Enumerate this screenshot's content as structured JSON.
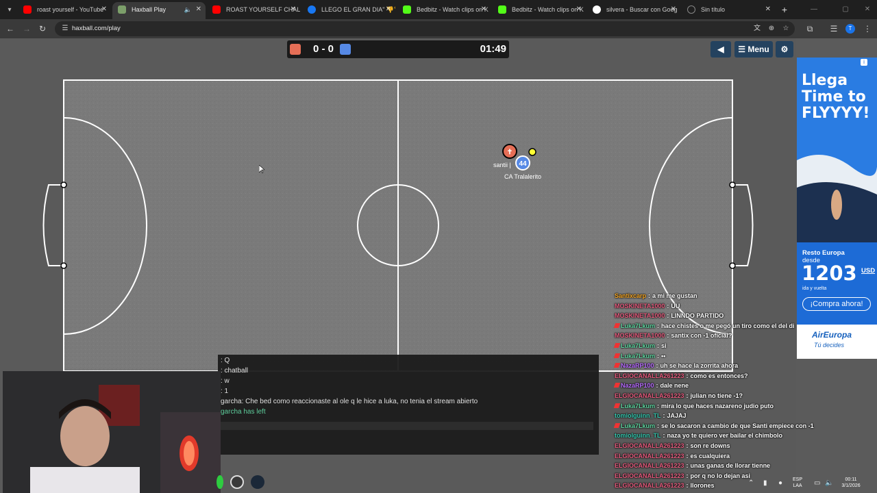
{
  "tabs": [
    {
      "title": "roast yourself - YouTube",
      "fav_color": "#ff0000"
    },
    {
      "title": "Haxball Play",
      "fav_color": "#7c9f6a"
    },
    {
      "title": "ROAST YOURSELF CHALL",
      "fav_color": "#ff0000"
    },
    {
      "title": "LLEGO EL GRAN DIA\" 👎🏆",
      "fav_color": "#1877f2"
    },
    {
      "title": "Bedbitz - Watch clips on K",
      "fav_color": "#53fc18"
    },
    {
      "title": "Bedbitz - Watch clips on K",
      "fav_color": "#53fc18"
    },
    {
      "title": "silvera - Buscar con Goog",
      "fav_color": "#ffffff"
    },
    {
      "title": "Sin título",
      "fav_color": "#1f1f1f"
    }
  ],
  "toolbar": {
    "url": "haxball.com/play"
  },
  "scoreboard": {
    "red_score": "0",
    "separator": "-",
    "blue_score": "0",
    "timer": "01:49",
    "red_color": "#e56e56",
    "blue_color": "#5689e5"
  },
  "game_menu": {
    "menu_label": "Menu"
  },
  "players": {
    "red_name": "santii |",
    "red_number": "✝",
    "blue_name": "CA Tralalerito",
    "blue_number": "44"
  },
  "chat": {
    "lines": [
      ": Q",
      ": chatball",
      ": w",
      ": 1",
      "garcha: Che bed como reaccionaste al ole q le hice a luka, no tenia el stream abierto"
    ],
    "system_line": "garcha has left"
  },
  "stream_chat": [
    {
      "user": "Santixcarp",
      "color": "#f5a623",
      "badge": false,
      "msg": "a mi me gustan"
    },
    {
      "user": "MOSKINETA1000",
      "color": "#e55b7d",
      "badge": false,
      "msg": "UU"
    },
    {
      "user": "MOSKINETA1000",
      "color": "#e55b7d",
      "badge": false,
      "msg": "LINNDO PARTIDO"
    },
    {
      "user": "Luka7Lkum",
      "color": "#5fd4a0",
      "badge": true,
      "msg": "hace chistes o me pegó un tiro como el del di"
    },
    {
      "user": "MOSKINETA1000",
      "color": "#e55b7d",
      "badge": false,
      "msg": "santix con -1 oficial?"
    },
    {
      "user": "Luka7Lkum",
      "color": "#5fd4a0",
      "badge": true,
      "msg": "si"
    },
    {
      "user": "Luka7Lkum",
      "color": "#5fd4a0",
      "badge": true,
      "msg": "••"
    },
    {
      "user": "NazaRP100",
      "color": "#b86dff",
      "badge": true,
      "msg": "uh se hace la zorrita ahora"
    },
    {
      "user": "ELGIOCANALLA261223",
      "color": "#e55b7d",
      "badge": false,
      "msg": "como es entonces?"
    },
    {
      "user": "NazaRP100",
      "color": "#b86dff",
      "badge": true,
      "msg": "dale nene"
    },
    {
      "user": "ELGIOCANALLA261223",
      "color": "#e55b7d",
      "badge": false,
      "msg": "julian no tiene -1?"
    },
    {
      "user": "Luka7Lkum",
      "color": "#5fd4a0",
      "badge": true,
      "msg": "mira lo que haces nazareno judio puto"
    },
    {
      "user": "tomiolguinn_TL",
      "color": "#36c9b0",
      "badge": false,
      "msg": "JAJAJ"
    },
    {
      "user": "Luka7Lkum",
      "color": "#5fd4a0",
      "badge": true,
      "msg": "se lo sacaron a cambio de que Santi empiece con -1"
    },
    {
      "user": "tomiolguinn_TL",
      "color": "#36c9b0",
      "badge": false,
      "msg": "naza yo te quiero ver bailar el chimbolo"
    },
    {
      "user": "ELGIOCANALLA261223",
      "color": "#e55b7d",
      "badge": false,
      "msg": "son re downs"
    },
    {
      "user": "ELGIOCANALLA261223",
      "color": "#e55b7d",
      "badge": false,
      "msg": "es cualquiera"
    },
    {
      "user": "ELGIOCANALLA261223",
      "color": "#e55b7d",
      "badge": false,
      "msg": "unas ganas de llorar tienne"
    },
    {
      "user": "ELGIOCANALLA261223",
      "color": "#e55b7d",
      "badge": false,
      "msg": "por q no lo dejan asi"
    },
    {
      "user": "ELGIOCANALLA261223",
      "color": "#e55b7d",
      "badge": false,
      "msg": "llorones"
    }
  ],
  "ad": {
    "headline_1": "Llega",
    "headline_2": "Time to",
    "headline_3": "FLYYYY!",
    "offer_line": "Resto Europa",
    "offer_from": "desde",
    "price": "1203",
    "currency": "USD",
    "trip": "ida y vuelta",
    "cta": "¡Compra ahora!",
    "brand": "AirEuropa",
    "tagline": "Tú decides"
  },
  "taskbar": {
    "lang_1": "ESP",
    "lang_2": "LAA",
    "time": "00:11",
    "date": "3/1/2026"
  }
}
